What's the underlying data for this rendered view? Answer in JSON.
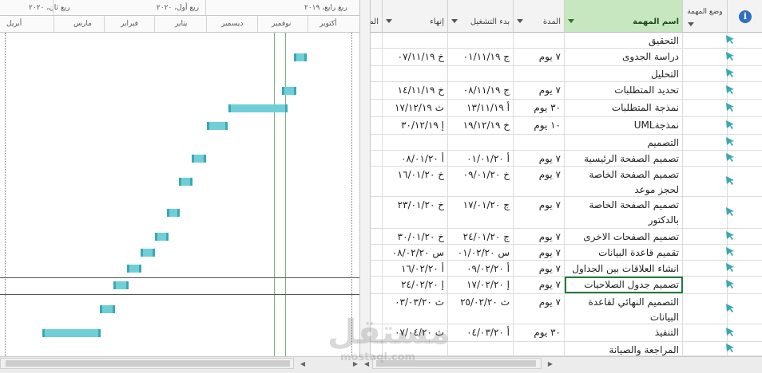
{
  "timeline": {
    "quarters": [
      "ربع ثان، ٢٠٢٠",
      "ربع أول، ٢٠٢٠",
      "ربع رابع، ٢٠١٩"
    ],
    "months": [
      "أبريل",
      "مارس",
      "فبراير",
      "يناير",
      "ديسمبر",
      "نوفمبر",
      "أكتوبر"
    ]
  },
  "columns": {
    "mode": "وضع المهمة",
    "name": "اسم المهمة",
    "duration": "المدة",
    "start": "بدء التشغيل",
    "finish": "إنهاء",
    "extra": "الم"
  },
  "icons": {
    "info": "info-icon",
    "task_mode": "pin-icon",
    "accent": "#3aa8b3",
    "bar_fill": "#6fcfd8",
    "header_active": "#c7e7c0"
  },
  "tasks": [
    {
      "name": "التحقيق",
      "duration": "",
      "start": "",
      "finish": ""
    },
    {
      "name": "دراسة الجدوى",
      "duration": "٧ يوم",
      "start": "ج ٠١/١١/١٩",
      "finish": "خ ٠٧/١١/١٩"
    },
    {
      "name": "التحليل",
      "duration": "",
      "start": "",
      "finish": ""
    },
    {
      "name": "تحديد المتطلبات",
      "duration": "٧ يوم",
      "start": "ج ٠٨/١١/١٩",
      "finish": "خ ١٤/١١/١٩"
    },
    {
      "name": "نمذجة المتطلبات",
      "duration": "٣٠ يوم",
      "start": "أ ١٣/١١/١٩",
      "finish": "ث ١٧/١٢/١٩"
    },
    {
      "name": "نمذجةUML",
      "duration": "١٠ يوم",
      "start": "خ ١٩/١٢/١٩",
      "finish": "إ ٣٠/١٢/١٩"
    },
    {
      "name": "التصميم",
      "duration": "",
      "start": "",
      "finish": ""
    },
    {
      "name": "تصميم الصفحة الرئيسية",
      "duration": "٧ يوم",
      "start": "أ ٠١/٠١/٢٠",
      "finish": "أ ٠٨/٠١/٢٠"
    },
    {
      "name": "تصميم الصفحة الخاصة لحجز موعد",
      "duration": "٧ يوم",
      "start": "خ ٠٩/٠١/٢٠",
      "finish": "خ ١٦/٠١/٢٠"
    },
    {
      "name": "تصميم الصفحة الخاصة بالدكتور",
      "duration": "٧ يوم",
      "start": "ج ١٧/٠١/٢٠",
      "finish": "خ ٢٣/٠١/٢٠"
    },
    {
      "name": "تصميم الصفحات الاخرى",
      "duration": "٧ يوم",
      "start": "ج ٢٤/٠١/٢٠",
      "finish": "خ ٣٠/٠١/٢٠"
    },
    {
      "name": "تقميم قاعدة البيانات",
      "duration": "٧ يوم",
      "start": "س ٠١/٠٢/٢٠",
      "finish": "س ٠٨/٠٢/٢٠"
    },
    {
      "name": "انشاء العلاقات بين الجداول",
      "duration": "٧ يوم",
      "start": "أ ٠٩/٠٢/٢٠",
      "finish": "أ ١٦/٠٢/٢٠"
    },
    {
      "name": "تصميم جدول الصلاحيات",
      "duration": "٧ يوم",
      "start": "إ ١٧/٠٢/٢٠",
      "finish": "إ ٢٤/٠٢/٢٠"
    },
    {
      "name": "التصميم النهائي لقاعدة البيانات",
      "duration": "٧ يوم",
      "start": "ث ٢٥/٠٢/٢٠",
      "finish": "ث ٠٣/٠٣/٢٠"
    },
    {
      "name": "التنفيذ",
      "duration": "٣٠ يوم",
      "start": "أ ٠٤/٠٣/٢٠",
      "finish": "ث ٠٧/٠٤/٢٠"
    },
    {
      "name": "المراجعة والصيانة",
      "duration": "",
      "start": "",
      "finish": ""
    }
  ],
  "watermark": {
    "brand": "مستقل",
    "url": "mostaql.com"
  }
}
